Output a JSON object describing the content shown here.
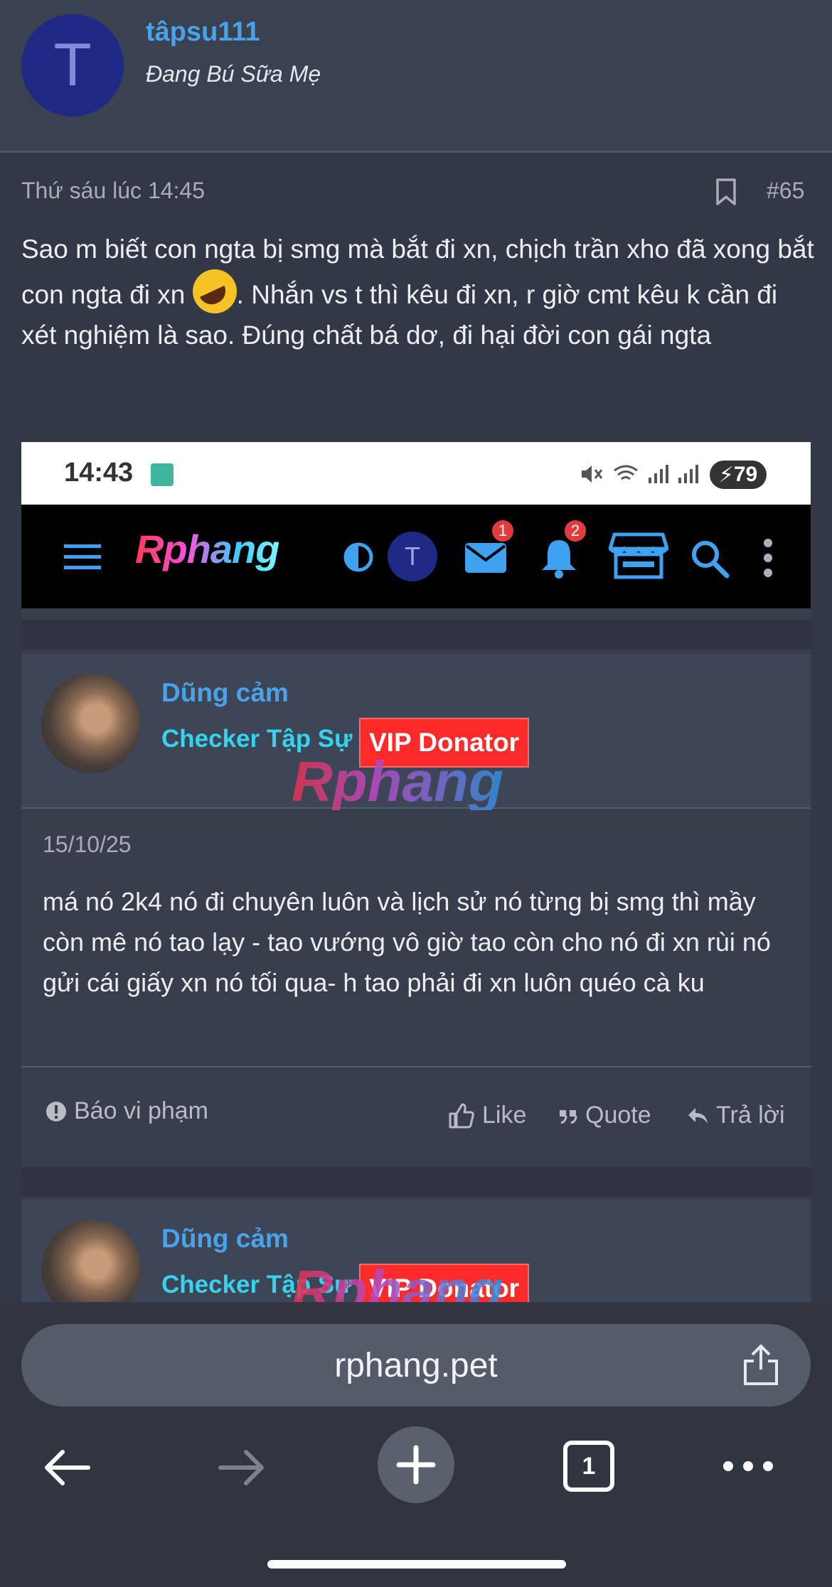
{
  "user": {
    "avatar_letter": "T",
    "name": "tâpsu111",
    "title": "Đang Bú Sữa Mẹ"
  },
  "post": {
    "date": "Thứ sáu lúc 14:45",
    "number": "#65",
    "text_1": "Sao m biết con ngta bị smg mà bắt đi xn, chịch trần xho đã xong bắt con ngta đi xn",
    "text_2": ". Nhắn vs t thì kêu đi xn, r giờ cmt kêu k cần đi xét nghiệm là sao. Đúng chất bá dơ, đi hại đời con gái ngta"
  },
  "screenshot": {
    "status": {
      "time": "14:43",
      "battery": "79"
    },
    "nav": {
      "logo": "Rphang",
      "avatar_letter": "T",
      "mail_badge": "1",
      "bell_badge": "2"
    },
    "messages": [
      {
        "name": "Dũng cảm",
        "role": "Checker Tập Sự",
        "badge": "VIP Donator",
        "watermark": "Rphang",
        "date": "15/10/25",
        "text": "má nó 2k4 nó đi chuyên luôn và lịch sử nó từng bị smg thì mầy còn mê nó tao lạy - tao vướng vô giờ tao còn cho nó đi xn rùi nó gửi cái giấy xn nó tối qua- h tao phải đi xn luôn quéo cà ku",
        "actions": {
          "report": "Báo vi phạm",
          "like": "Like",
          "quote": "Quote",
          "reply": "Trả lời"
        }
      },
      {
        "name": "Dũng cảm",
        "role": "Checker Tập Sự",
        "badge": "VIP Donator",
        "watermark": "Rphang"
      }
    ]
  },
  "browser": {
    "url": "rphang.pet",
    "tab_count": "1"
  },
  "colors": {
    "background": "#323845",
    "link_blue": "#4aa3e8",
    "role_cyan": "#35d3ee",
    "vip_red": "#ff2b2b"
  }
}
